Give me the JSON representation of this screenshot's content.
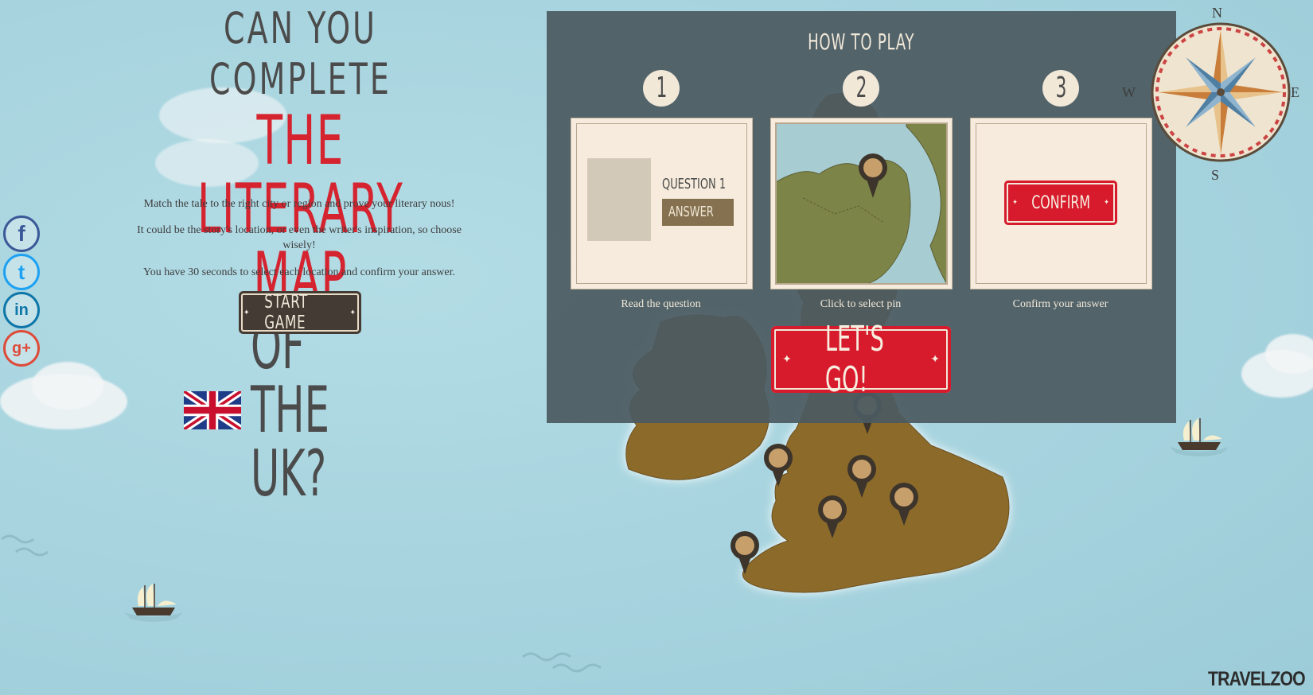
{
  "title": {
    "line1": "CAN YOU COMPLETE",
    "line2": "THE LITERARY MAP",
    "line3": "OF THE UK?"
  },
  "intro": {
    "p1": "Match the tale to the right city or region and prove your literary nous!",
    "p2": "It could be the story's location, or even the writer's inspiration, so choose wisely!",
    "p3": "You have 30 seconds to select each location and confirm your answer."
  },
  "start_button": {
    "label": "START GAME"
  },
  "social": [
    {
      "name": "facebook",
      "glyph": "f",
      "color": "#3b5998"
    },
    {
      "name": "twitter",
      "glyph": "t",
      "color": "#1da1f2"
    },
    {
      "name": "linkedin",
      "glyph": "in",
      "color": "#0e76a8"
    },
    {
      "name": "google-plus",
      "glyph": "g+",
      "color": "#dd4b39"
    }
  ],
  "how_to_play": {
    "title": "HOW TO PLAY",
    "steps": [
      {
        "number": "1",
        "caption": "Read the question",
        "card_question": "QUESTION 1",
        "card_answer": "ANSWER"
      },
      {
        "number": "2",
        "caption": "Click to select pin"
      },
      {
        "number": "3",
        "caption": "Confirm your answer",
        "card_button": "CONFIRM"
      }
    ],
    "cta": "LET'S GO!"
  },
  "compass": {
    "n": "N",
    "s": "S",
    "e": "E",
    "w": "W"
  },
  "brand": {
    "logo": "TRAVELZOO"
  },
  "colors": {
    "accent_red": "#d71a2c",
    "sea": "#a6d3de",
    "panel": "#4b5a61",
    "cream": "#f1e8d8",
    "dark_brown": "#433b34"
  }
}
